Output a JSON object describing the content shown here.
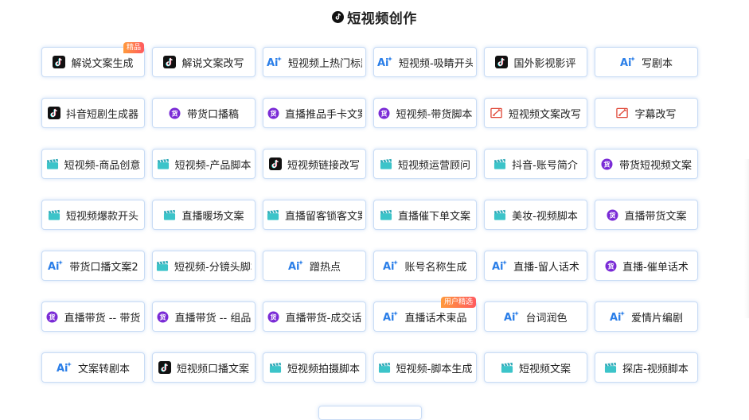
{
  "header": {
    "title": "短视频创作",
    "logo_icon": "tiktok-logo-icon"
  },
  "colors": {
    "card_border": "#c9dcf5",
    "ai_blue": "#2a7ee8",
    "huo_purple": "#7a2bd6",
    "clap_teal": "#3cc4c9",
    "edit_red": "#e04a3a",
    "badge_orange": "#ff7a45"
  },
  "cards": [
    {
      "label": "解说文案生成",
      "icon": "tiktok",
      "badge": "精品"
    },
    {
      "label": "解说文案改写",
      "icon": "tiktok"
    },
    {
      "label": "短视频上热门标题",
      "icon": "ai"
    },
    {
      "label": "短视频-吸睛开头",
      "icon": "ai"
    },
    {
      "label": "国外影视影评",
      "icon": "tiktok"
    },
    {
      "label": "写剧本",
      "icon": "ai"
    },
    {
      "label": "抖音短剧生成器",
      "icon": "tiktok"
    },
    {
      "label": "带货口播稿",
      "icon": "huo"
    },
    {
      "label": "直播推品手卡文案",
      "icon": "huo"
    },
    {
      "label": "短视频-带货脚本",
      "icon": "huo"
    },
    {
      "label": "短视频文案改写",
      "icon": "edit"
    },
    {
      "label": "字幕改写",
      "icon": "edit"
    },
    {
      "label": "短视频-商品创意",
      "icon": "clap"
    },
    {
      "label": "短视频-产品脚本",
      "icon": "clap"
    },
    {
      "label": "短视频链接改写",
      "icon": "tiktok"
    },
    {
      "label": "短视频运营顾问",
      "icon": "clap"
    },
    {
      "label": "抖音-账号简介",
      "icon": "clap"
    },
    {
      "label": "带货短视频文案",
      "icon": "huo"
    },
    {
      "label": "短视频爆款开头",
      "icon": "clap"
    },
    {
      "label": "直播暖场文案",
      "icon": "clap"
    },
    {
      "label": "直播留客锁客文案",
      "icon": "clap"
    },
    {
      "label": "直播催下单文案",
      "icon": "clap"
    },
    {
      "label": "美妆-视频脚本",
      "icon": "clap"
    },
    {
      "label": "直播带货文案",
      "icon": "huo"
    },
    {
      "label": "带货口播文案2",
      "icon": "ai"
    },
    {
      "label": "短视频-分镜头脚本",
      "icon": "clap"
    },
    {
      "label": "蹭热点",
      "icon": "ai"
    },
    {
      "label": "账号名称生成",
      "icon": "ai"
    },
    {
      "label": "直播-留人话术",
      "icon": "ai"
    },
    {
      "label": "直播-催单话术",
      "icon": "huo"
    },
    {
      "label": "直播带货 -- 带货",
      "icon": "huo"
    },
    {
      "label": "直播带货 -- 组品",
      "icon": "huo"
    },
    {
      "label": "直播带货-成交话",
      "icon": "huo"
    },
    {
      "label": "直播话术束品",
      "icon": "ai",
      "badge": "用户精选"
    },
    {
      "label": "台词润色",
      "icon": "ai"
    },
    {
      "label": "爱情片编剧",
      "icon": "ai"
    },
    {
      "label": "文案转剧本",
      "icon": "ai"
    },
    {
      "label": "短视频口播文案",
      "icon": "tiktok"
    },
    {
      "label": "短视频拍摄脚本",
      "icon": "clap"
    },
    {
      "label": "短视频-脚本生成",
      "icon": "clap"
    },
    {
      "label": "短视频文案",
      "icon": "clap"
    },
    {
      "label": "探店-视频脚本",
      "icon": "clap"
    }
  ],
  "icon_names": {
    "tiktok": "tiktok-icon",
    "ai": "ai-sparkle-icon",
    "huo": "goods-badge-icon",
    "clap": "clapperboard-icon",
    "edit": "edit-pen-icon"
  },
  "huo_glyph": "货"
}
